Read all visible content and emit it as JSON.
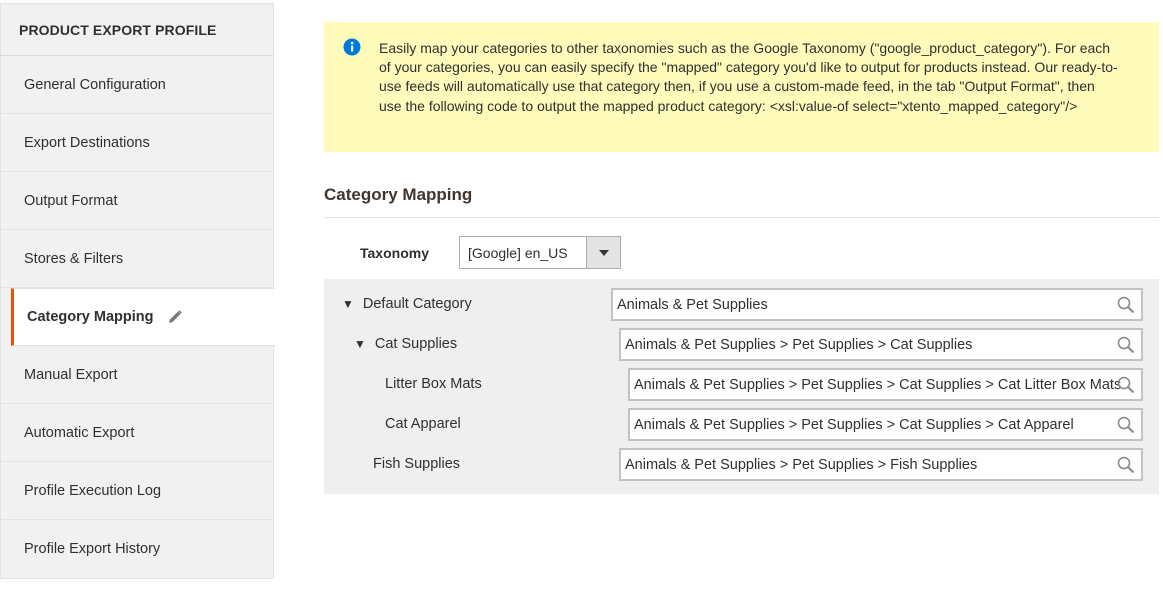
{
  "sidebar": {
    "title": "PRODUCT EXPORT PROFILE",
    "items": [
      {
        "label": "General Configuration"
      },
      {
        "label": "Export Destinations"
      },
      {
        "label": "Output Format"
      },
      {
        "label": "Stores & Filters"
      },
      {
        "label": "Category Mapping"
      },
      {
        "label": "Manual Export"
      },
      {
        "label": "Automatic Export"
      },
      {
        "label": "Profile Execution Log"
      },
      {
        "label": "Profile Export History"
      }
    ]
  },
  "notice": {
    "text": "Easily map your categories to other taxonomies such as the Google Taxonomy (\"google_product_category\"). For each of your categories, you can easily specify the \"mapped\" category you'd like to output for products instead. Our ready-to-use feeds will automatically use that category then, if you use a custom-made feed, in the tab \"Output Format\", then use the following code to output the mapped product category: <xsl:value-of select=\"xtento_mapped_category\"/>"
  },
  "section": {
    "title": "Category Mapping"
  },
  "taxonomy": {
    "label": "Taxonomy",
    "value": "[Google] en_US"
  },
  "tree": [
    {
      "label": "Default Category",
      "toggle": "▼",
      "mapped": "Animals & Pet Supplies"
    },
    {
      "label": "Cat Supplies",
      "toggle": "▼",
      "mapped": "Animals & Pet Supplies > Pet Supplies > Cat Supplies"
    },
    {
      "label": "Litter Box Mats",
      "toggle": "",
      "mapped": "Animals & Pet Supplies > Pet Supplies > Cat Supplies > Cat Litter Box Mats"
    },
    {
      "label": "Cat Apparel",
      "toggle": "",
      "mapped": "Animals & Pet Supplies > Pet Supplies > Cat Supplies > Cat Apparel"
    },
    {
      "label": "Fish Supplies",
      "toggle": "",
      "mapped": "Animals & Pet Supplies > Pet Supplies > Fish Supplies"
    }
  ],
  "colors": {
    "accent": "#eb5202",
    "notice_bg": "#fffbbb",
    "info_icon": "#007bdb"
  }
}
